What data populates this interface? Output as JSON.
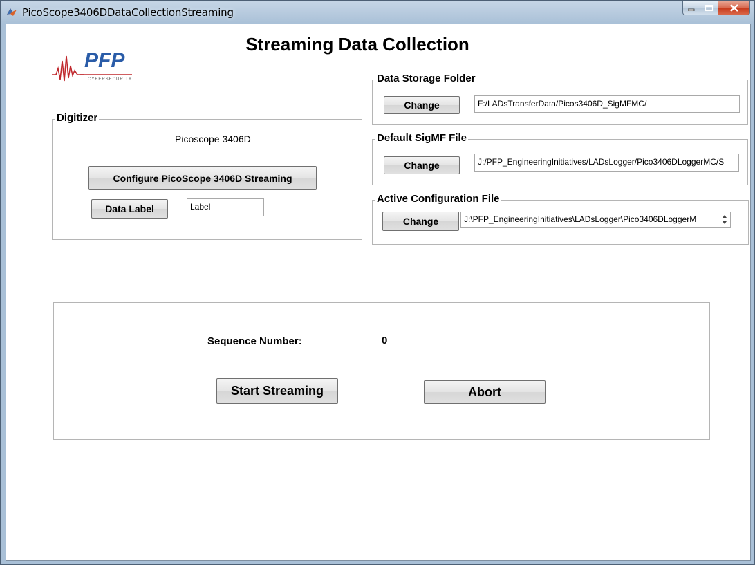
{
  "window": {
    "title": "PicoScope3406DDataCollectionStreaming"
  },
  "page_title": "Streaming Data Collection",
  "logo": {
    "text": "PFP",
    "tagline": "CYBERSECURITY",
    "icon": "pfp-logo"
  },
  "digitizer": {
    "panel_title": "Digitizer",
    "device_name": "Picoscope 3406D",
    "configure_label": "Configure PicoScope 3406D Streaming",
    "data_label_button": "Data Label",
    "data_label_value": "Label"
  },
  "storage": {
    "panel_title": "Data Storage Folder",
    "change_label": "Change",
    "path": "F:/LADsTransferData/Picos3406D_SigMFMC/"
  },
  "sigmf": {
    "panel_title": "Default SigMF File",
    "change_label": "Change",
    "path": "J:/PFP_EngineeringInitiatives/LADsLogger/Pico3406DLoggerMC/S"
  },
  "config": {
    "panel_title": "Active Configuration File",
    "change_label": "Change",
    "path": "J:\\PFP_EngineeringInitiatives\\LADsLogger\\Pico3406DLoggerM"
  },
  "control": {
    "sequence_label": "Sequence Number:",
    "sequence_value": "0",
    "start_label": "Start Streaming",
    "abort_label": "Abort"
  },
  "colors": {
    "logo_blue": "#2a5ca8",
    "logo_red": "#c0282d"
  }
}
